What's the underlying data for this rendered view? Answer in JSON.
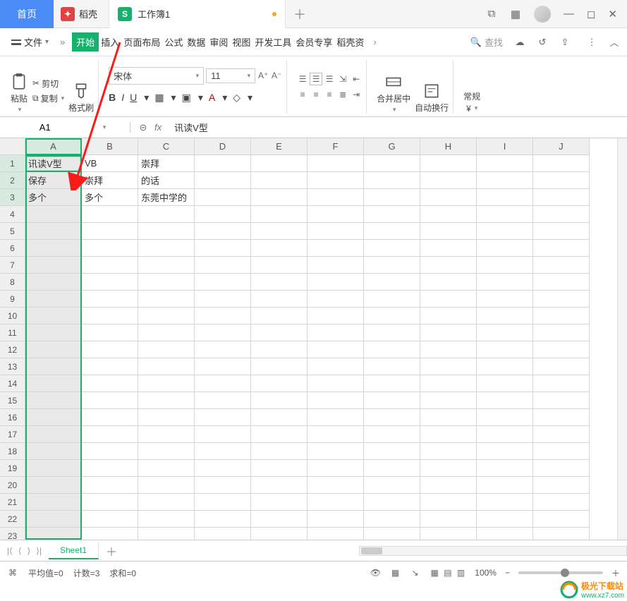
{
  "titlebar": {
    "home_tab": "首页",
    "docer_tab": "稻壳",
    "workbook_tab": "工作簿1",
    "workbook_modified": true
  },
  "menubar": {
    "file_label": "文件",
    "tabs": [
      "开始",
      "插入",
      "页面布局",
      "公式",
      "数据",
      "审阅",
      "视图",
      "开发工具",
      "会员专享",
      "稻壳资"
    ],
    "active_tab_index": 0,
    "search_placeholder": "查找"
  },
  "ribbon": {
    "paste": "粘贴",
    "cut": "剪切",
    "copy": "复制",
    "format_painter": "格式刷",
    "font_name": "宋体",
    "font_size": "11",
    "merge_center": "合并居中",
    "wrap_text": "自动换行",
    "number_format": "常规"
  },
  "namebox": {
    "value": "A1"
  },
  "formula": {
    "value": "讯读V型"
  },
  "columns": [
    "A",
    "B",
    "C",
    "D",
    "E",
    "F",
    "G",
    "H",
    "I",
    "J"
  ],
  "rows": [
    1,
    2,
    3,
    4,
    5,
    6,
    7,
    8,
    9,
    10,
    11,
    12,
    13,
    14,
    15,
    16,
    17,
    18,
    19,
    20,
    21,
    22,
    23
  ],
  "selected_column_index": 0,
  "cells": {
    "A1": "讯读V型",
    "B1": "VB",
    "C1": "崇拜",
    "A2": "保存",
    "B2": "崇拜",
    "C2": "的话",
    "A3": "多个",
    "B3": "多个",
    "C3": "东莞中学的"
  },
  "sheets": {
    "active": "Sheet1"
  },
  "statusbar": {
    "avg_label": "平均值=0",
    "count_label": "计数=3",
    "sum_label": "求和=0",
    "zoom": "100%"
  },
  "watermark": {
    "title": "极光下载站",
    "url": "www.xz7.com"
  }
}
